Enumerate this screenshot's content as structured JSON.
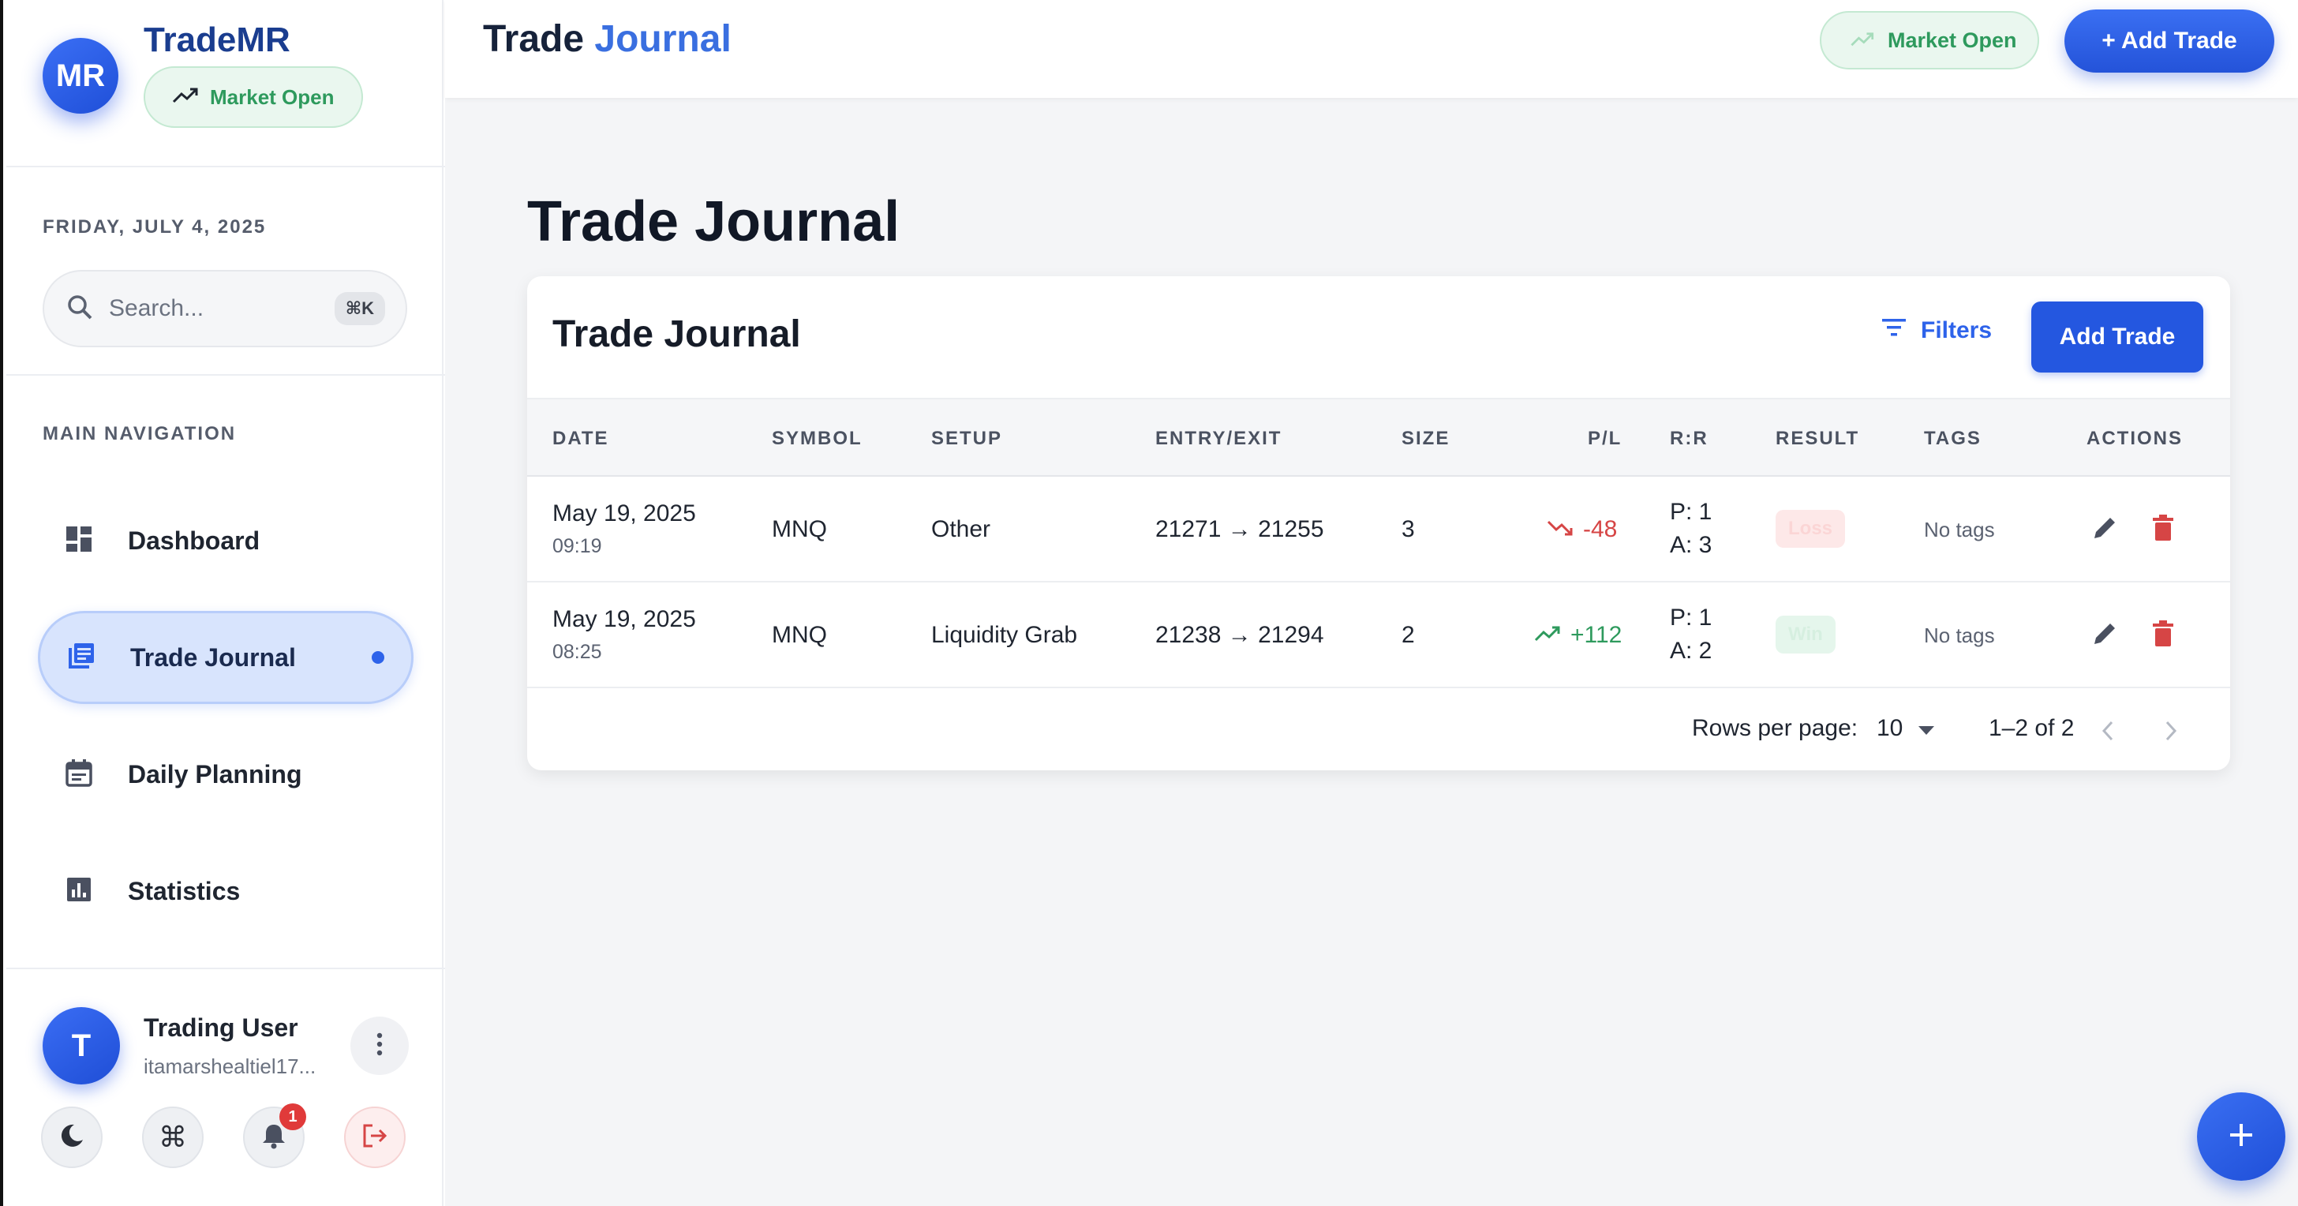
{
  "brand": {
    "avatar_text": "MR",
    "name": "TradeMR",
    "market_status": "Market Open"
  },
  "sidebar": {
    "date": "FRIDAY, JULY 4, 2025",
    "search": {
      "placeholder": "Search...",
      "shortcut": "⌘K"
    },
    "nav_title": "MAIN NAVIGATION",
    "items": [
      {
        "label": "Dashboard",
        "icon": "dashboard-icon",
        "active": false
      },
      {
        "label": "Trade Journal",
        "icon": "journal-icon",
        "active": true
      },
      {
        "label": "Daily Planning",
        "icon": "calendar-icon",
        "active": false
      },
      {
        "label": "Statistics",
        "icon": "chart-icon",
        "active": false
      }
    ],
    "user": {
      "initial": "T",
      "name": "Trading User",
      "email": "itamarshealtiel17..."
    },
    "notifications_count": "1"
  },
  "topbar": {
    "title_part1": "Trade ",
    "title_part2": "Journal",
    "market_status": "Market Open",
    "add_button": "+ Add Trade"
  },
  "main": {
    "page_title": "Trade Journal",
    "card_title": "Trade Journal",
    "filters_label": "Filters",
    "add_button": "Add Trade",
    "columns": [
      "DATE",
      "SYMBOL",
      "SETUP",
      "ENTRY/EXIT",
      "SIZE",
      "P/L",
      "R:R",
      "RESULT",
      "TAGS",
      "ACTIONS"
    ],
    "rows": [
      {
        "date": "May 19, 2025",
        "time": "09:19",
        "symbol": "MNQ",
        "setup": "Other",
        "entry_exit": "21271 → 21255",
        "size": "3",
        "pl": "-48",
        "pl_dir": "down",
        "rr_p": "P: 1",
        "rr_a": "A: 3",
        "result": "Loss",
        "tags": "No tags"
      },
      {
        "date": "May 19, 2025",
        "time": "08:25",
        "symbol": "MNQ",
        "setup": "Liquidity Grab",
        "entry_exit": "21238 → 21294",
        "size": "2",
        "pl": "+112",
        "pl_dir": "up",
        "rr_p": "P: 1",
        "rr_a": "A: 2",
        "result": "Win",
        "tags": "No tags"
      }
    ],
    "pagination": {
      "rows_label": "Rows per page:",
      "rows_value": "10",
      "range": "1–2 of 2"
    }
  },
  "colors": {
    "accent": "#2457e0",
    "profit": "#2e9a5d",
    "loss": "#d64545"
  }
}
